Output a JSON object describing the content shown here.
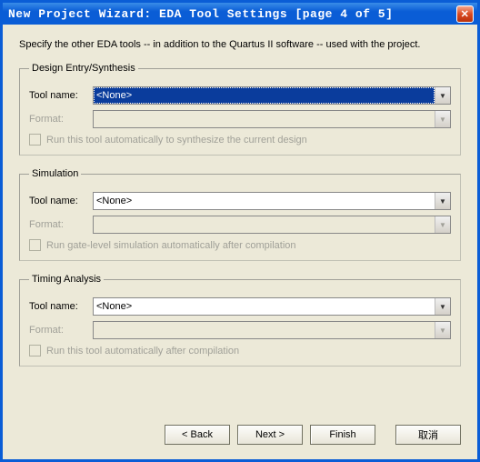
{
  "window": {
    "title": "New Project Wizard: EDA Tool Settings [page 4 of 5]"
  },
  "intro": "Specify the other EDA tools -- in addition to the Quartus II software -- used with the project.",
  "groups": {
    "design": {
      "legend": "Design Entry/Synthesis",
      "tool_label": "Tool name:",
      "tool_value": "<None>",
      "format_label": "Format:",
      "format_value": "",
      "checkbox_text": "Run this tool automatically to synthesize the current design"
    },
    "simulation": {
      "legend": "Simulation",
      "tool_label": "Tool name:",
      "tool_value": "<None>",
      "format_label": "Format:",
      "format_value": "",
      "checkbox_text": "Run gate-level simulation automatically after compilation"
    },
    "timing": {
      "legend": "Timing Analysis",
      "tool_label": "Tool name:",
      "tool_value": "<None>",
      "format_label": "Format:",
      "format_value": "",
      "checkbox_text": "Run this tool automatically after compilation"
    }
  },
  "buttons": {
    "back": "< Back",
    "next": "Next >",
    "finish": "Finish",
    "cancel": "取消"
  }
}
